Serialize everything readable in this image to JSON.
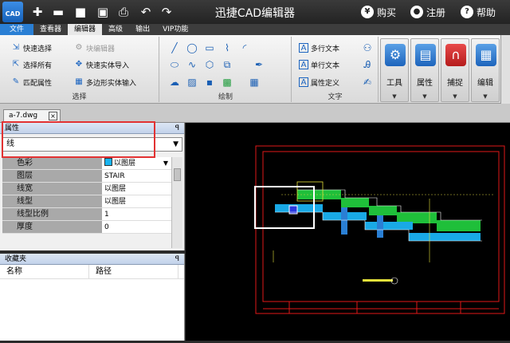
{
  "app": {
    "title": "迅捷CAD编辑器",
    "logo_text": "CAD"
  },
  "quick_access": [
    {
      "icon": "add-icon",
      "glyph": "✚"
    },
    {
      "icon": "open-folder-icon",
      "glyph": "▬"
    },
    {
      "icon": "save-icon",
      "glyph": "■"
    },
    {
      "icon": "save-as-icon",
      "glyph": "▣"
    },
    {
      "icon": "print-icon",
      "glyph": "⎙"
    },
    {
      "icon": "undo-icon",
      "glyph": "↶"
    },
    {
      "icon": "redo-icon",
      "glyph": "↷"
    }
  ],
  "title_actions": {
    "buy": "购买",
    "register": "注册",
    "help": "帮助",
    "buy_glyph": "¥",
    "register_glyph": "●",
    "help_glyph": "?"
  },
  "menu": {
    "tabs": [
      "文件",
      "查看器",
      "编辑器",
      "高级",
      "输出",
      "VIP功能"
    ],
    "active": "编辑器"
  },
  "ribbon": {
    "select": {
      "label": "选择",
      "items": [
        "快速选择",
        "选择所有",
        "匹配属性",
        "块编辑器",
        "快速实体导入",
        "多边形实体输入"
      ]
    },
    "draw": {
      "label": "绘制"
    },
    "text": {
      "label": "文字",
      "items": [
        "多行文本",
        "单行文本",
        "属性定义"
      ]
    },
    "big_buttons": [
      "工具",
      "属性",
      "捕捉",
      "编辑"
    ]
  },
  "document": {
    "tab": "a-7.dwg",
    "close_glyph": "×"
  },
  "properties": {
    "title": "属性",
    "pin": "ꟼ",
    "selected_type": "线",
    "rows": [
      {
        "key": "色彩",
        "value": "以图层",
        "swatch": "#18b4f0"
      },
      {
        "key": "图层",
        "value": "STAIR"
      },
      {
        "key": "线宽",
        "value": "以图层"
      },
      {
        "key": "线型",
        "value": "以图层"
      },
      {
        "key": "线型比例",
        "value": "1"
      },
      {
        "key": "厚度",
        "value": "0"
      }
    ]
  },
  "favorites": {
    "title": "收藏夹",
    "columns": [
      "名称",
      "路径"
    ]
  },
  "colors": {
    "cad_background": "#000000",
    "frame": "#e01818",
    "fill_green": "#1fbf3a",
    "fill_cyan": "#19a9e6",
    "accent_blue": "#2a7fd4"
  }
}
